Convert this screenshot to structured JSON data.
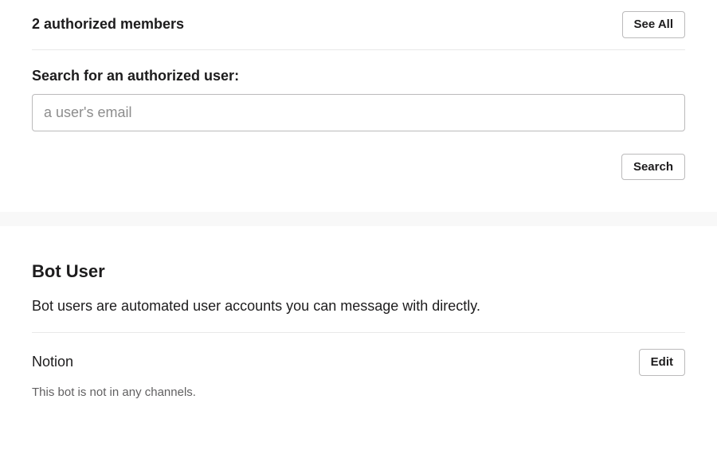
{
  "members": {
    "title": "2 authorized members",
    "see_all_label": "See All"
  },
  "search": {
    "label": "Search for an authorized user:",
    "placeholder": "a user's email",
    "button_label": "Search"
  },
  "bot": {
    "title": "Bot User",
    "description": "Bot users are automated user accounts you can message with directly.",
    "entry": {
      "name": "Notion",
      "status": "This bot is not in any channels.",
      "edit_label": "Edit"
    }
  }
}
